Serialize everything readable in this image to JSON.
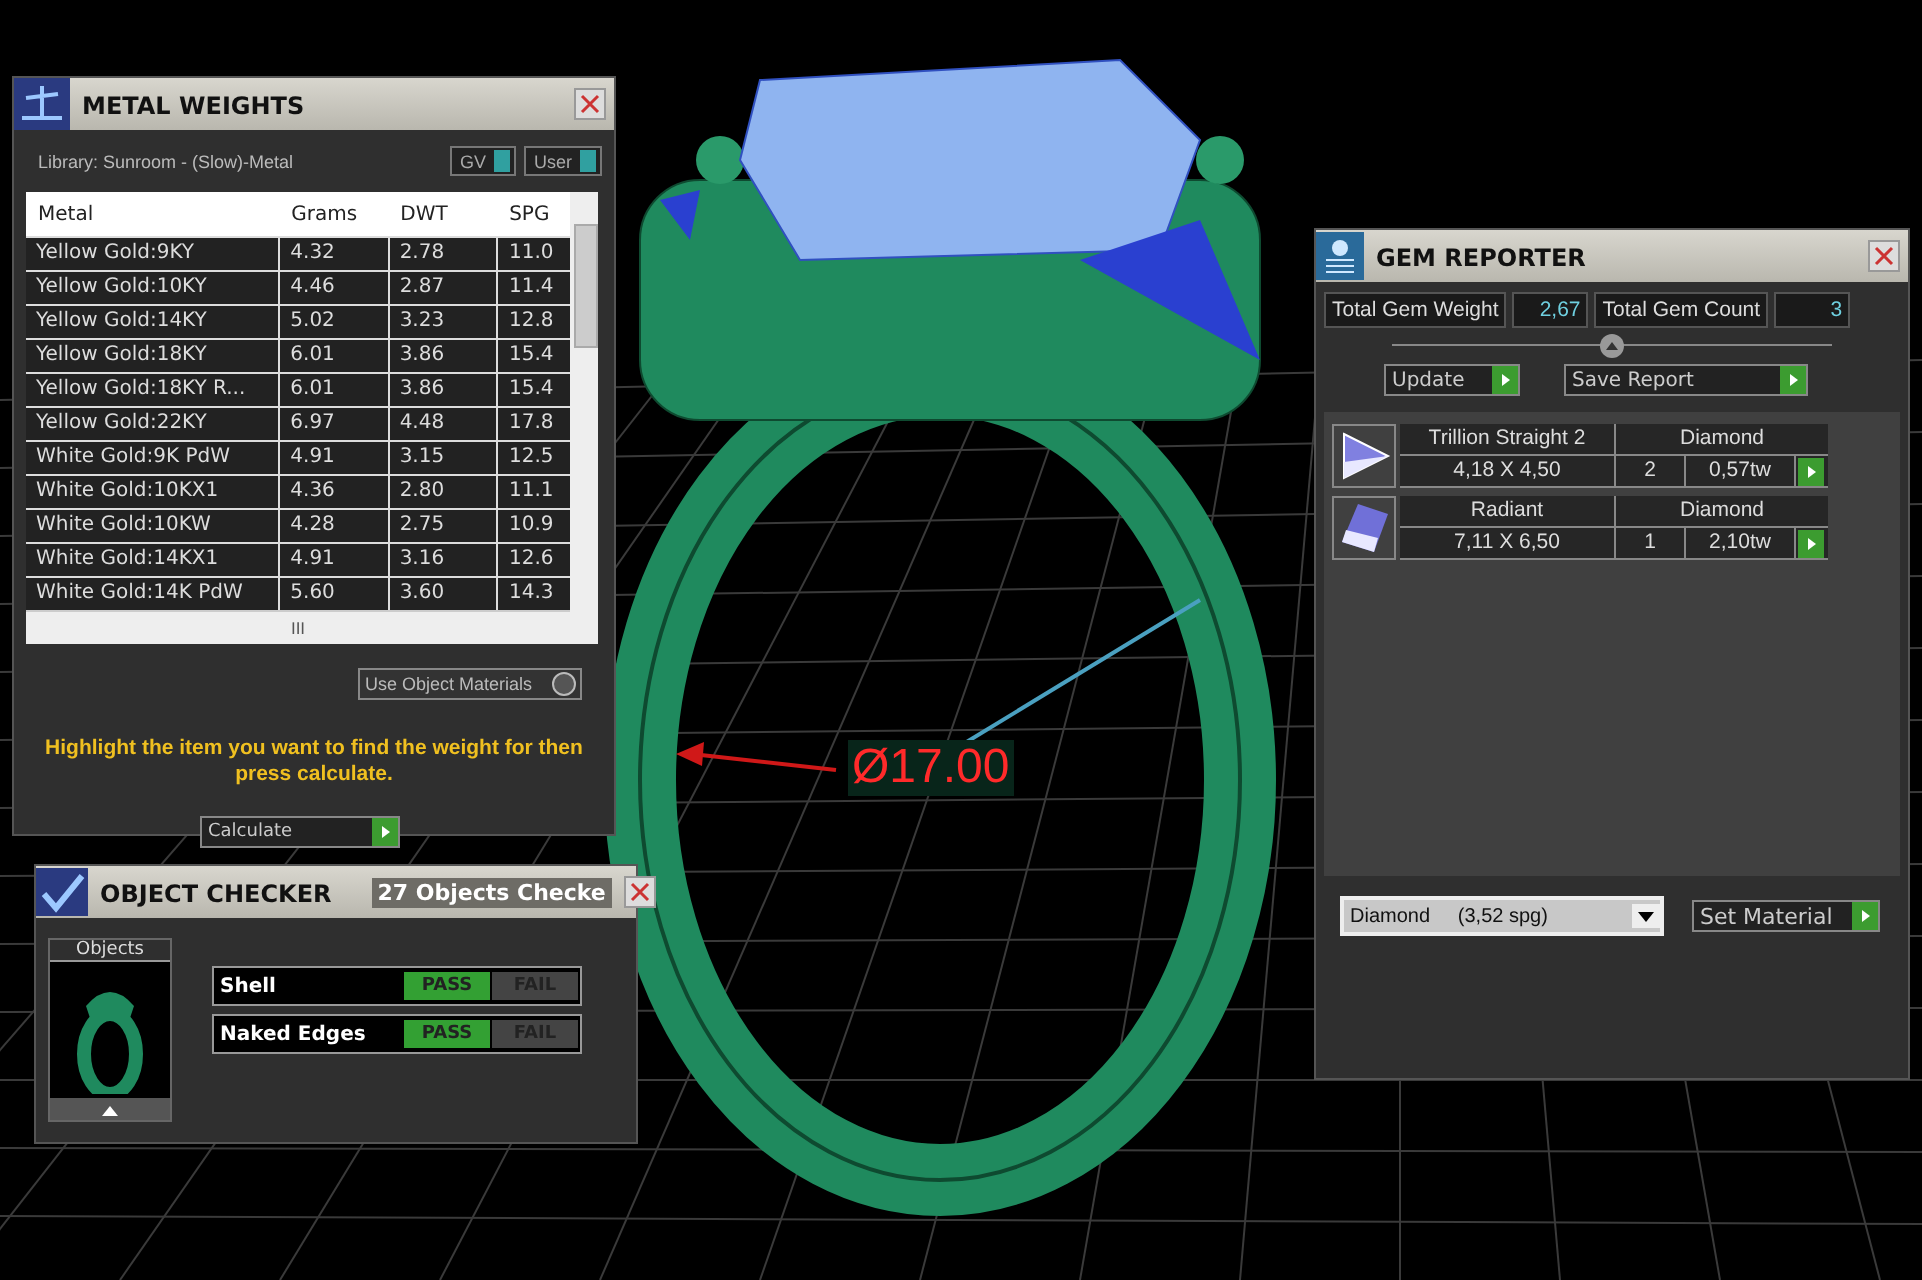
{
  "viewport": {
    "dimension": "Ø17.00"
  },
  "metal_weights": {
    "title": "METAL WEIGHTS",
    "library": "Library: Sunroom - (Slow)-Metal",
    "toggles": [
      {
        "label": "GV",
        "on": true
      },
      {
        "label": "User",
        "on": true
      }
    ],
    "columns": [
      "Metal",
      "Grams",
      "DWT",
      "SPG"
    ],
    "rows": [
      [
        "Yellow Gold:9KY",
        "4.32",
        "2.78",
        "11.0"
      ],
      [
        "Yellow Gold:10KY",
        "4.46",
        "2.87",
        "11.4"
      ],
      [
        "Yellow Gold:14KY",
        "5.02",
        "3.23",
        "12.8"
      ],
      [
        "Yellow Gold:18KY",
        "6.01",
        "3.86",
        "15.4"
      ],
      [
        "Yellow Gold:18KY R...",
        "6.01",
        "3.86",
        "15.4"
      ],
      [
        "Yellow Gold:22KY",
        "6.97",
        "4.48",
        "17.8"
      ],
      [
        "White Gold:9K PdW",
        "4.91",
        "3.15",
        "12.5"
      ],
      [
        "White Gold:10KX1",
        "4.36",
        "2.80",
        "11.1"
      ],
      [
        "White Gold:10KW",
        "4.28",
        "2.75",
        "10.9"
      ],
      [
        "White Gold:14KX1",
        "4.91",
        "3.16",
        "12.6"
      ],
      [
        "White Gold:14K PdW",
        "5.60",
        "3.60",
        "14.3"
      ]
    ],
    "scroll_grip": "III",
    "use_object_materials": {
      "label": "Use Object Materials",
      "checked": false
    },
    "hint": "Highlight the item you want to find the weight for then press calculate.",
    "calculate": "Calculate"
  },
  "object_checker": {
    "title": "OBJECT CHECKER",
    "status": "27  Objects Checke",
    "objects_label": "Objects",
    "checks": [
      {
        "name": "Shell",
        "passed": true,
        "pass_label": "PASS",
        "fail_label": "FAIL"
      },
      {
        "name": "Naked Edges",
        "passed": true,
        "pass_label": "PASS",
        "fail_label": "FAIL"
      }
    ]
  },
  "gem_reporter": {
    "title": "GEM REPORTER",
    "weight_label": "Total Gem Weight",
    "weight": "2,67",
    "count_label": "Total Gem Count",
    "count": "3",
    "buttons": [
      "Update",
      "Save Report"
    ],
    "gems": [
      {
        "kind": "trillion",
        "name": "Trillion Straight 2",
        "material": "Diamond",
        "size": "4,18 X 4,50",
        "count": "2",
        "weight": "0,57tw"
      },
      {
        "kind": "radiant",
        "name": "Radiant",
        "material": "Diamond",
        "size": "7,11 X 6,50",
        "count": "1",
        "weight": "2,10tw"
      }
    ],
    "material": "Diamond     (3,52 spg)",
    "set_material": "Set Material"
  }
}
